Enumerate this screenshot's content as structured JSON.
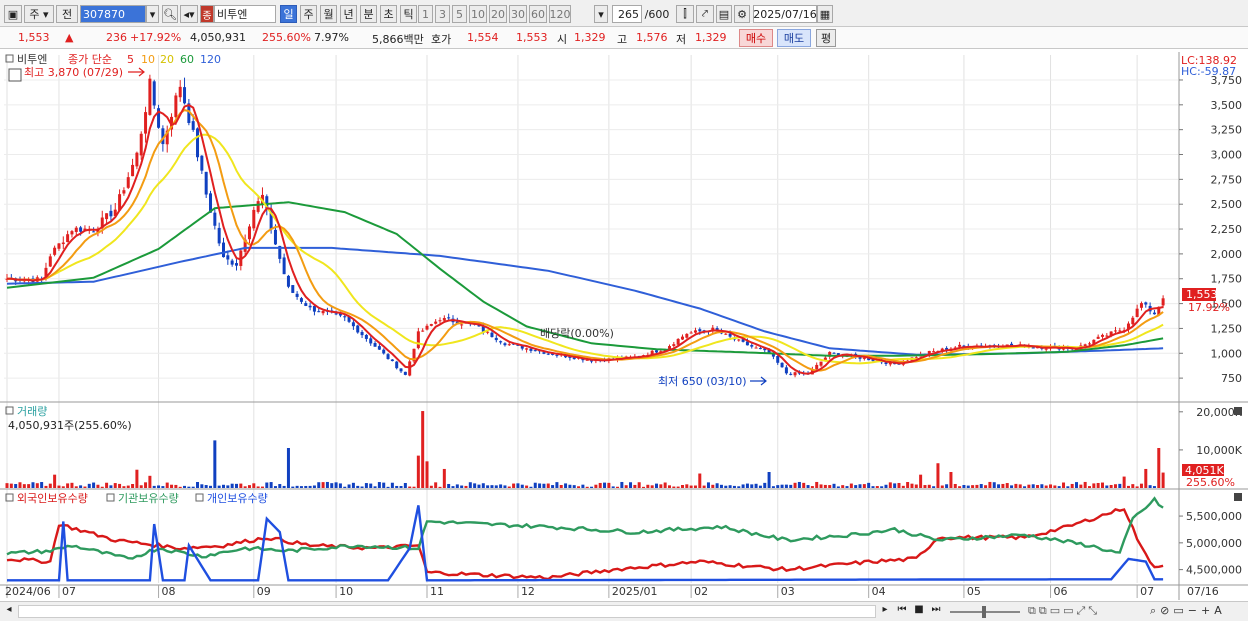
{
  "toolbar": {
    "period_label": "주",
    "prev_label": "전",
    "code": "307870",
    "name": "비투엔",
    "name_prefix": "종",
    "tf_tabs": [
      "일",
      "주",
      "월",
      "년",
      "분",
      "초",
      "틱"
    ],
    "num_tabs": [
      "1",
      "3",
      "5",
      "10",
      "20",
      "30",
      "60",
      "120"
    ],
    "bar_count": "265",
    "bar_total": "/600",
    "date": "2025/07/16"
  },
  "quote": {
    "price": "1,553",
    "change": "236",
    "change_pct": "+17.92%",
    "volume": "4,050,931",
    "volume_pct": "255.60%",
    "turnover": "7.97%",
    "amount": "5,866백만",
    "hoga_label": "호가",
    "ask": "1,554",
    "bid": "1,553",
    "open_label": "시",
    "open": "1,329",
    "high_label": "고",
    "high": "1,576",
    "low_label": "저",
    "low": "1,329",
    "buy_label": "매수",
    "sell_label": "매도",
    "eval_label": "평"
  },
  "colors": {
    "up": "#e02020",
    "down": "#1040c0",
    "ma5": "#e02020",
    "ma10": "#f39c12",
    "ma20": "#f0e61e",
    "ma60": "#1b9a3a",
    "ma120": "#2f5fd8",
    "foreign": "#d81818",
    "inst": "#2e9a5e",
    "indiv": "#1f4fe0"
  },
  "chart_data": [
    {
      "type": "candlestick",
      "panel_title": "비투엔",
      "legend": [
        "종가 단순",
        "5",
        "10",
        "20",
        "60",
        "120"
      ],
      "ylim": [
        560,
        3800
      ],
      "y_ticks": [
        750,
        1000,
        1250,
        1500,
        1750,
        2000,
        2250,
        2500,
        2750,
        3000,
        3250,
        3500,
        3750
      ],
      "lc_label": "LC:138.92",
      "hc_label": "HC:-59.87",
      "last_price_label": "1,553",
      "last_pct_label": "17.92%",
      "annotations": {
        "high_label": "최고 3,870 (07/29)",
        "low_label": "최저 650 (03/10)",
        "dividend_label": "배당락(0.00%)"
      },
      "close_waypoints": [
        {
          "d": 0,
          "v": 1750
        },
        {
          "d": 8,
          "v": 1740
        },
        {
          "d": 10,
          "v": 1990
        },
        {
          "d": 15,
          "v": 2250
        },
        {
          "d": 20,
          "v": 2250
        },
        {
          "d": 25,
          "v": 2450
        },
        {
          "d": 30,
          "v": 3000
        },
        {
          "d": 33,
          "v": 3700
        },
        {
          "d": 36,
          "v": 3100
        },
        {
          "d": 38,
          "v": 3420
        },
        {
          "d": 40,
          "v": 3700
        },
        {
          "d": 43,
          "v": 3200
        },
        {
          "d": 46,
          "v": 2600
        },
        {
          "d": 50,
          "v": 1950
        },
        {
          "d": 53,
          "v": 1900
        },
        {
          "d": 57,
          "v": 2450
        },
        {
          "d": 59,
          "v": 2580
        },
        {
          "d": 62,
          "v": 2100
        },
        {
          "d": 65,
          "v": 1650
        },
        {
          "d": 70,
          "v": 1450
        },
        {
          "d": 78,
          "v": 1350
        },
        {
          "d": 88,
          "v": 950
        },
        {
          "d": 92,
          "v": 780
        },
        {
          "d": 95,
          "v": 1200
        },
        {
          "d": 100,
          "v": 1350
        },
        {
          "d": 108,
          "v": 1280
        },
        {
          "d": 115,
          "v": 1100
        },
        {
          "d": 125,
          "v": 1000
        },
        {
          "d": 135,
          "v": 930
        },
        {
          "d": 145,
          "v": 960
        },
        {
          "d": 152,
          "v": 1050
        },
        {
          "d": 157,
          "v": 1200
        },
        {
          "d": 163,
          "v": 1240
        },
        {
          "d": 170,
          "v": 1100
        },
        {
          "d": 176,
          "v": 1000
        },
        {
          "d": 180,
          "v": 800
        },
        {
          "d": 185,
          "v": 790
        },
        {
          "d": 190,
          "v": 1000
        },
        {
          "d": 198,
          "v": 950
        },
        {
          "d": 205,
          "v": 890
        },
        {
          "d": 212,
          "v": 1000
        },
        {
          "d": 220,
          "v": 1070
        },
        {
          "d": 232,
          "v": 1080
        },
        {
          "d": 240,
          "v": 1060
        },
        {
          "d": 247,
          "v": 1050
        },
        {
          "d": 252,
          "v": 1150
        },
        {
          "d": 258,
          "v": 1250
        },
        {
          "d": 262,
          "v": 1500
        },
        {
          "d": 265,
          "v": 1400
        },
        {
          "d": 267,
          "v": 1553
        }
      ],
      "ma60_waypoints": [
        {
          "d": 0,
          "v": 1660
        },
        {
          "d": 20,
          "v": 1760
        },
        {
          "d": 35,
          "v": 2050
        },
        {
          "d": 48,
          "v": 2460
        },
        {
          "d": 65,
          "v": 2520
        },
        {
          "d": 78,
          "v": 2420
        },
        {
          "d": 90,
          "v": 2200
        },
        {
          "d": 100,
          "v": 1850
        },
        {
          "d": 110,
          "v": 1520
        },
        {
          "d": 120,
          "v": 1270
        },
        {
          "d": 135,
          "v": 1100
        },
        {
          "d": 150,
          "v": 1040
        },
        {
          "d": 170,
          "v": 1010
        },
        {
          "d": 190,
          "v": 975
        },
        {
          "d": 205,
          "v": 975
        },
        {
          "d": 225,
          "v": 990
        },
        {
          "d": 245,
          "v": 1015
        },
        {
          "d": 258,
          "v": 1080
        },
        {
          "d": 267,
          "v": 1150
        }
      ],
      "ma120_waypoints": [
        {
          "d": 0,
          "v": 1700
        },
        {
          "d": 20,
          "v": 1720
        },
        {
          "d": 40,
          "v": 1920
        },
        {
          "d": 55,
          "v": 2060
        },
        {
          "d": 75,
          "v": 2060
        },
        {
          "d": 100,
          "v": 1980
        },
        {
          "d": 125,
          "v": 1830
        },
        {
          "d": 145,
          "v": 1630
        },
        {
          "d": 160,
          "v": 1450
        },
        {
          "d": 175,
          "v": 1220
        },
        {
          "d": 190,
          "v": 1050
        },
        {
          "d": 210,
          "v": 985
        },
        {
          "d": 235,
          "v": 1000
        },
        {
          "d": 255,
          "v": 1030
        },
        {
          "d": 267,
          "v": 1050
        }
      ]
    },
    {
      "type": "bar",
      "panel_title": "거래량",
      "value_label": "4,050,931주(255.60%)",
      "y_tick_labels": [
        "20,000K",
        "10,000K"
      ],
      "y_tick_values": [
        20000,
        10000
      ],
      "ylim": [
        0,
        21000
      ],
      "last_label": "4,051K",
      "last_pct_label": "255.60%",
      "spikes": [
        {
          "d": 11,
          "v": 3500,
          "dir": "up"
        },
        {
          "d": 30,
          "v": 4800,
          "dir": "up"
        },
        {
          "d": 33,
          "v": 3200,
          "dir": "up"
        },
        {
          "d": 48,
          "v": 12500,
          "dir": "down"
        },
        {
          "d": 65,
          "v": 10500,
          "dir": "down"
        },
        {
          "d": 96,
          "v": 20200,
          "dir": "up"
        },
        {
          "d": 95,
          "v": 8500,
          "dir": "up"
        },
        {
          "d": 97,
          "v": 7000,
          "dir": "up"
        },
        {
          "d": 101,
          "v": 5000,
          "dir": "up"
        },
        {
          "d": 160,
          "v": 3800,
          "dir": "up"
        },
        {
          "d": 176,
          "v": 4200,
          "dir": "down"
        },
        {
          "d": 211,
          "v": 3500,
          "dir": "up"
        },
        {
          "d": 215,
          "v": 6500,
          "dir": "up"
        },
        {
          "d": 218,
          "v": 4200,
          "dir": "up"
        },
        {
          "d": 258,
          "v": 3000,
          "dir": "up"
        },
        {
          "d": 263,
          "v": 5000,
          "dir": "up"
        },
        {
          "d": 266,
          "v": 10500,
          "dir": "up"
        },
        {
          "d": 267,
          "v": 4051,
          "dir": "up"
        }
      ]
    },
    {
      "type": "line",
      "panel_title": "",
      "legend": [
        "외국인보유수량",
        "기관보유수량",
        "개인보유수량"
      ],
      "y_tick_labels": [
        "5,500,000",
        "5,000,000",
        "4,500,000"
      ],
      "y_tick_values": [
        5500000,
        5000000,
        4500000
      ],
      "ylim": [
        4250000,
        5800000
      ],
      "series": [
        {
          "name": "외국인보유수량",
          "waypoints": [
            {
              "d": 0,
              "v": 4700000
            },
            {
              "d": 10,
              "v": 4650000
            },
            {
              "d": 12,
              "v": 5350000
            },
            {
              "d": 25,
              "v": 5050000
            },
            {
              "d": 40,
              "v": 4900000
            },
            {
              "d": 50,
              "v": 4950000
            },
            {
              "d": 60,
              "v": 5100000
            },
            {
              "d": 70,
              "v": 4950000
            },
            {
              "d": 85,
              "v": 4900000
            },
            {
              "d": 95,
              "v": 4950000
            },
            {
              "d": 97,
              "v": 4450000
            },
            {
              "d": 110,
              "v": 4400000
            },
            {
              "d": 125,
              "v": 4350000
            },
            {
              "d": 140,
              "v": 4500000
            },
            {
              "d": 160,
              "v": 4650000
            },
            {
              "d": 180,
              "v": 4500000
            },
            {
              "d": 200,
              "v": 4650000
            },
            {
              "d": 210,
              "v": 4700000
            },
            {
              "d": 215,
              "v": 5100000
            },
            {
              "d": 235,
              "v": 5100000
            },
            {
              "d": 245,
              "v": 5300000
            },
            {
              "d": 258,
              "v": 5650000
            },
            {
              "d": 262,
              "v": 4900000
            },
            {
              "d": 265,
              "v": 4550000
            },
            {
              "d": 267,
              "v": 4600000
            }
          ]
        },
        {
          "name": "기관보유수량",
          "waypoints": [
            {
              "d": 0,
              "v": 4800000
            },
            {
              "d": 10,
              "v": 4850000
            },
            {
              "d": 15,
              "v": 4950000
            },
            {
              "d": 28,
              "v": 4700000
            },
            {
              "d": 35,
              "v": 4900000
            },
            {
              "d": 45,
              "v": 4750000
            },
            {
              "d": 55,
              "v": 4900000
            },
            {
              "d": 65,
              "v": 4850000
            },
            {
              "d": 80,
              "v": 4950000
            },
            {
              "d": 95,
              "v": 4900000
            },
            {
              "d": 97,
              "v": 5400000
            },
            {
              "d": 110,
              "v": 5350000
            },
            {
              "d": 125,
              "v": 5300000
            },
            {
              "d": 145,
              "v": 5200000
            },
            {
              "d": 165,
              "v": 5300000
            },
            {
              "d": 180,
              "v": 5050000
            },
            {
              "d": 195,
              "v": 5150000
            },
            {
              "d": 205,
              "v": 5250000
            },
            {
              "d": 215,
              "v": 5050000
            },
            {
              "d": 235,
              "v": 5150000
            },
            {
              "d": 250,
              "v": 4950000
            },
            {
              "d": 257,
              "v": 4800000
            },
            {
              "d": 260,
              "v": 5450000
            },
            {
              "d": 265,
              "v": 5800000
            },
            {
              "d": 267,
              "v": 5650000
            }
          ]
        },
        {
          "name": "개인보유수량",
          "waypoints": [
            {
              "d": 0,
              "v": 4300000
            },
            {
              "d": 12,
              "v": 4300000
            },
            {
              "d": 13,
              "v": 5400000
            },
            {
              "d": 14,
              "v": 4300000
            },
            {
              "d": 33,
              "v": 4300000
            },
            {
              "d": 34,
              "v": 5350000
            },
            {
              "d": 36,
              "v": 4300000
            },
            {
              "d": 41,
              "v": 4300000
            },
            {
              "d": 42,
              "v": 4950000
            },
            {
              "d": 47,
              "v": 4300000
            },
            {
              "d": 58,
              "v": 4300000
            },
            {
              "d": 60,
              "v": 5450000
            },
            {
              "d": 63,
              "v": 5200000
            },
            {
              "d": 65,
              "v": 4300000
            },
            {
              "d": 88,
              "v": 4300000
            },
            {
              "d": 93,
              "v": 4900000
            },
            {
              "d": 95,
              "v": 5700000
            },
            {
              "d": 97,
              "v": 4300000
            },
            {
              "d": 255,
              "v": 4320000
            },
            {
              "d": 259,
              "v": 4700000
            },
            {
              "d": 263,
              "v": 4650000
            },
            {
              "d": 265,
              "v": 4320000
            },
            {
              "d": 267,
              "v": 4320000
            }
          ]
        }
      ]
    }
  ],
  "x_axis": {
    "labels": [
      {
        "d": 0,
        "t": "2024/06"
      },
      {
        "d": 12,
        "t": "07"
      },
      {
        "d": 35,
        "t": "08"
      },
      {
        "d": 57,
        "t": "09"
      },
      {
        "d": 76,
        "t": "10"
      },
      {
        "d": 97,
        "t": "11"
      },
      {
        "d": 118,
        "t": "12"
      },
      {
        "d": 139,
        "t": "2025/01"
      },
      {
        "d": 158,
        "t": "02"
      },
      {
        "d": 178,
        "t": "03"
      },
      {
        "d": 199,
        "t": "04"
      },
      {
        "d": 221,
        "t": "05"
      },
      {
        "d": 241,
        "t": "06"
      },
      {
        "d": 261,
        "t": "07"
      }
    ],
    "right_label": "07/16"
  }
}
